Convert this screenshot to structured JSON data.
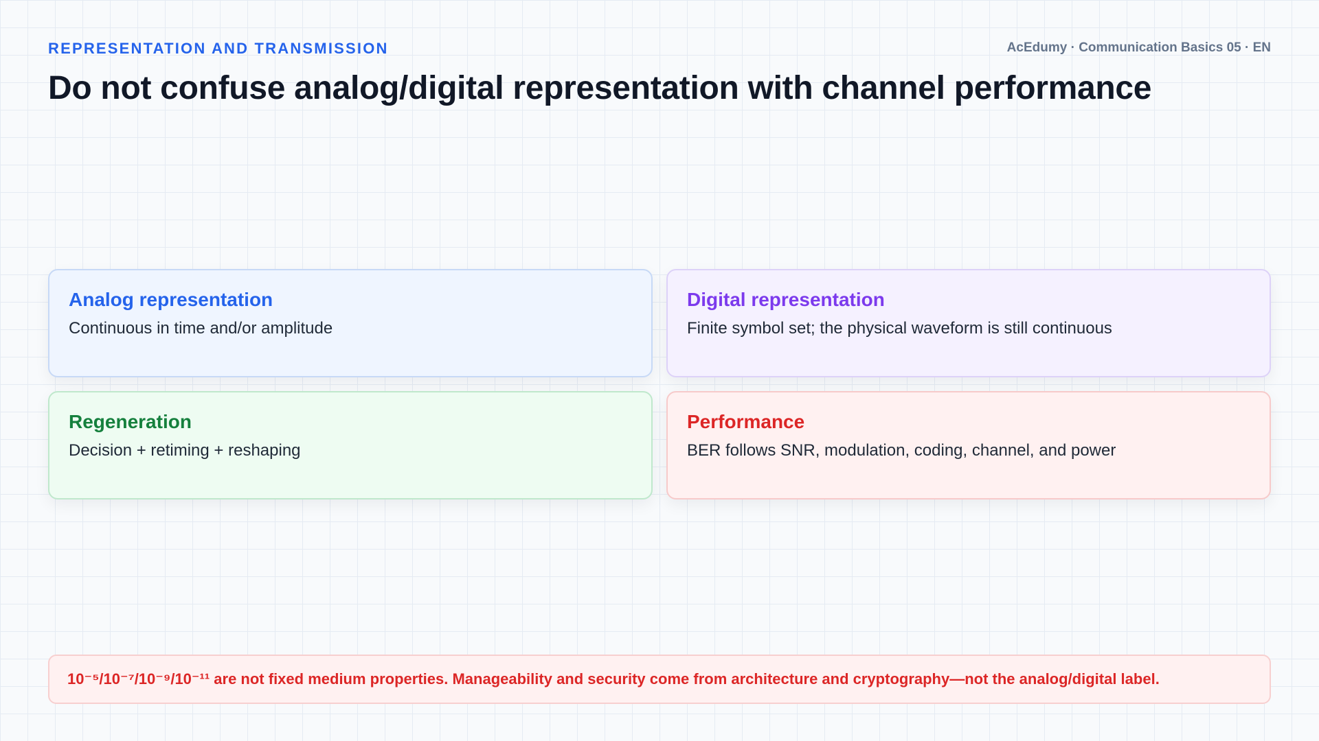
{
  "header": {
    "kicker": "REPRESENTATION AND TRANSMISSION",
    "meta": "AcEdumy · Communication Basics 05 · EN",
    "title": "Do not confuse analog/digital representation with channel performance"
  },
  "cards": [
    {
      "title": "Analog representation",
      "text": "Continuous in time and/or amplitude",
      "accent": "#2563eb"
    },
    {
      "title": "Digital representation",
      "text": "Finite symbol set; the physical waveform is still continuous",
      "accent": "#7c3aed"
    },
    {
      "title": "Regeneration",
      "text": "Decision + retiming + reshaping",
      "accent": "#15803d"
    },
    {
      "title": "Performance",
      "text": "BER follows SNR, modulation, coding, channel, and power",
      "accent": "#dc2626"
    }
  ],
  "notice": {
    "text": "10⁻⁵/10⁻⁷/10⁻⁹/10⁻¹¹ are not fixed medium properties. Manageability and security come from architecture and cryptography—not the analog/digital label.",
    "color": "#dc2626"
  }
}
